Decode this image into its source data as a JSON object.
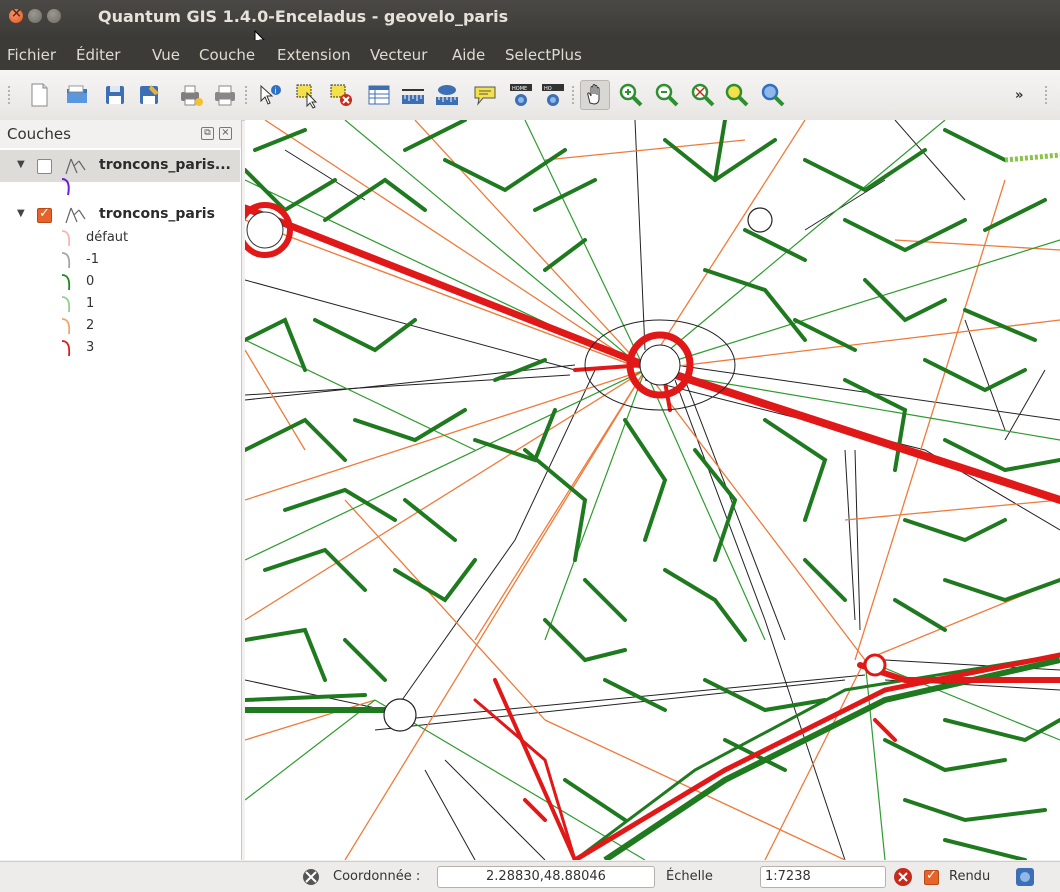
{
  "window": {
    "title": "Quantum GIS 1.4.0-Enceladus - geovelo_paris"
  },
  "menubar": {
    "items": [
      {
        "label": "Fichier"
      },
      {
        "label": "Éditer"
      },
      {
        "label": "Vue"
      },
      {
        "label": "Couche"
      },
      {
        "label": "Extension"
      },
      {
        "label": "Vecteur"
      },
      {
        "label": "Aide"
      },
      {
        "label": "SelectPlus"
      }
    ]
  },
  "toolbar": {
    "icons": [
      "new-project-icon",
      "open-project-icon",
      "save-project-icon",
      "save-as-icon",
      "print-composer-icon",
      "print-icon",
      "identify-icon",
      "select-features-icon",
      "deselect-features-icon",
      "attribute-table-icon",
      "measure-line-icon",
      "measure-area-icon",
      "map-tips-icon",
      "zoom-home-icon",
      "zoom-full-icon",
      "pan-icon",
      "zoom-in-icon",
      "zoom-out-icon",
      "zoom-selection-icon",
      "zoom-layer-icon",
      "zoom-last-icon"
    ],
    "more": "»"
  },
  "layers_panel": {
    "title": "Couches",
    "layers": [
      {
        "name": "troncons_paris...",
        "checked": false
      },
      {
        "name": "troncons_paris",
        "checked": true,
        "legend": [
          {
            "label": "défaut",
            "color": "#f2b8b0"
          },
          {
            "label": "-1",
            "color": "#a5a5a0"
          },
          {
            "label": "0",
            "color": "#1a8a1a"
          },
          {
            "label": "1",
            "color": "#8fd08f"
          },
          {
            "label": "2",
            "color": "#f4a468"
          },
          {
            "label": "3",
            "color": "#e01818"
          }
        ]
      }
    ]
  },
  "statusbar": {
    "coord_label": "Coordonnée :",
    "coord_value": "2.28830,48.88046",
    "scale_label": "Échelle",
    "scale_value": "1:7238",
    "render_label": "Rendu"
  },
  "colors": {
    "major_road": "#e01818",
    "cycle_path": "#1f7a1f",
    "street_orange": "#f07a3a",
    "street_green": "#2e9b2e"
  }
}
